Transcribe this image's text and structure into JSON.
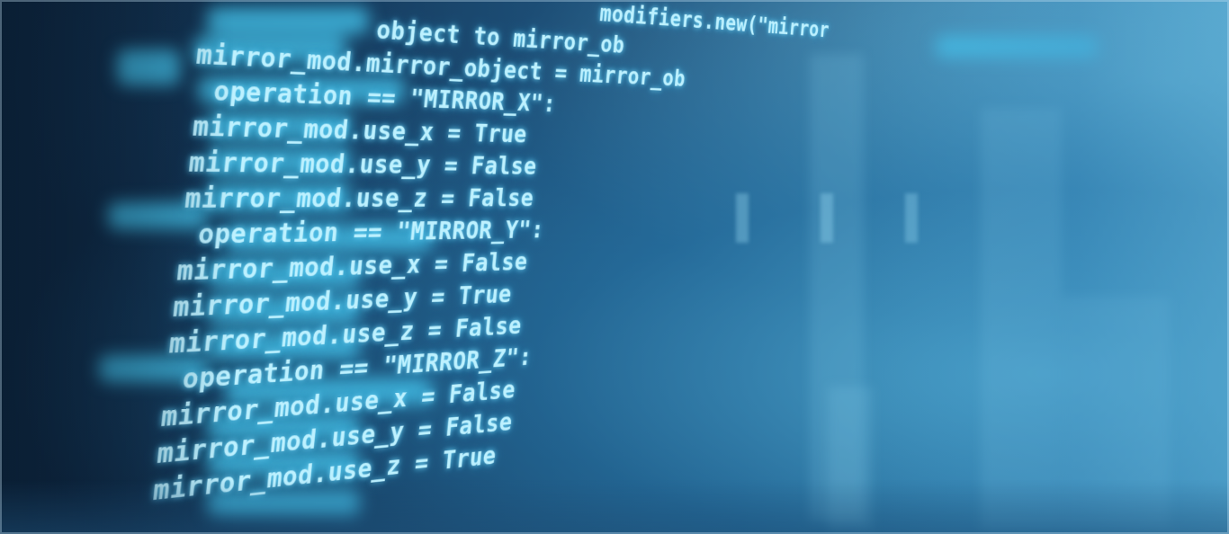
{
  "image": {
    "subject": "code-on-screen-photo",
    "colors": {
      "background_dark": "#0c2138",
      "background_light": "#3d8db8",
      "code_text": "#bdf1ff",
      "glow": "#46c8f0"
    }
  },
  "code": {
    "lines": [
      "modifiers.new(\"mirror",
      "object to mirror_ob",
      "mirror_mod.mirror_object = mirror_ob",
      "operation == \"MIRROR_X\":",
      "mirror_mod.use_x = True",
      "mirror_mod.use_y = False",
      "mirror_mod.use_z = False",
      "operation == \"MIRROR_Y\":",
      "mirror_mod.use_x = False",
      "mirror_mod.use_y = True",
      "mirror_mod.use_z = False",
      "operation == \"MIRROR_Z\":",
      "mirror_mod.use_x = False",
      "mirror_mod.use_y = False",
      "mirror_mod.use_z = True"
    ]
  }
}
